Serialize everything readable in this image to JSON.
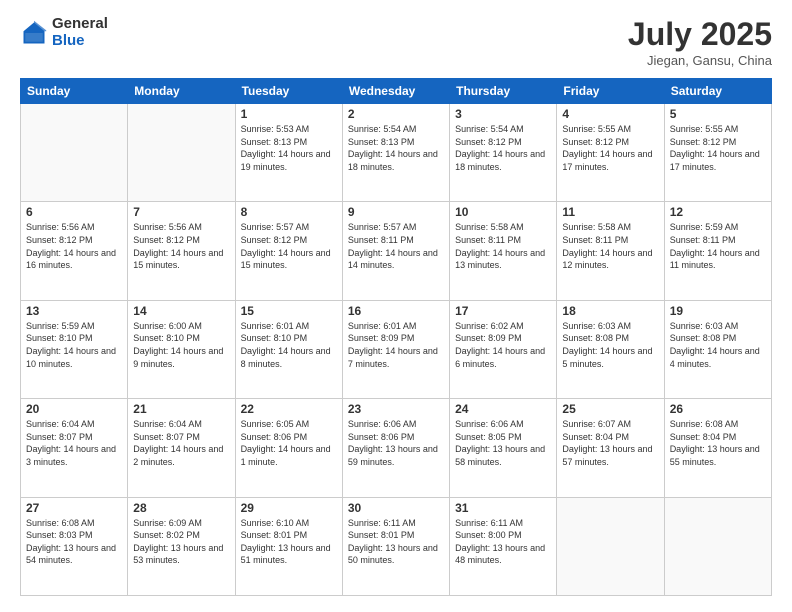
{
  "header": {
    "logo_general": "General",
    "logo_blue": "Blue",
    "month_title": "July 2025",
    "subtitle": "Jiegan, Gansu, China"
  },
  "weekdays": [
    "Sunday",
    "Monday",
    "Tuesday",
    "Wednesday",
    "Thursday",
    "Friday",
    "Saturday"
  ],
  "weeks": [
    [
      {
        "day": "",
        "sunrise": "",
        "sunset": "",
        "daylight": "",
        "empty": true
      },
      {
        "day": "",
        "sunrise": "",
        "sunset": "",
        "daylight": "",
        "empty": true
      },
      {
        "day": "1",
        "sunrise": "Sunrise: 5:53 AM",
        "sunset": "Sunset: 8:13 PM",
        "daylight": "Daylight: 14 hours and 19 minutes.",
        "empty": false
      },
      {
        "day": "2",
        "sunrise": "Sunrise: 5:54 AM",
        "sunset": "Sunset: 8:13 PM",
        "daylight": "Daylight: 14 hours and 18 minutes.",
        "empty": false
      },
      {
        "day": "3",
        "sunrise": "Sunrise: 5:54 AM",
        "sunset": "Sunset: 8:12 PM",
        "daylight": "Daylight: 14 hours and 18 minutes.",
        "empty": false
      },
      {
        "day": "4",
        "sunrise": "Sunrise: 5:55 AM",
        "sunset": "Sunset: 8:12 PM",
        "daylight": "Daylight: 14 hours and 17 minutes.",
        "empty": false
      },
      {
        "day": "5",
        "sunrise": "Sunrise: 5:55 AM",
        "sunset": "Sunset: 8:12 PM",
        "daylight": "Daylight: 14 hours and 17 minutes.",
        "empty": false
      }
    ],
    [
      {
        "day": "6",
        "sunrise": "Sunrise: 5:56 AM",
        "sunset": "Sunset: 8:12 PM",
        "daylight": "Daylight: 14 hours and 16 minutes.",
        "empty": false
      },
      {
        "day": "7",
        "sunrise": "Sunrise: 5:56 AM",
        "sunset": "Sunset: 8:12 PM",
        "daylight": "Daylight: 14 hours and 15 minutes.",
        "empty": false
      },
      {
        "day": "8",
        "sunrise": "Sunrise: 5:57 AM",
        "sunset": "Sunset: 8:12 PM",
        "daylight": "Daylight: 14 hours and 15 minutes.",
        "empty": false
      },
      {
        "day": "9",
        "sunrise": "Sunrise: 5:57 AM",
        "sunset": "Sunset: 8:11 PM",
        "daylight": "Daylight: 14 hours and 14 minutes.",
        "empty": false
      },
      {
        "day": "10",
        "sunrise": "Sunrise: 5:58 AM",
        "sunset": "Sunset: 8:11 PM",
        "daylight": "Daylight: 14 hours and 13 minutes.",
        "empty": false
      },
      {
        "day": "11",
        "sunrise": "Sunrise: 5:58 AM",
        "sunset": "Sunset: 8:11 PM",
        "daylight": "Daylight: 14 hours and 12 minutes.",
        "empty": false
      },
      {
        "day": "12",
        "sunrise": "Sunrise: 5:59 AM",
        "sunset": "Sunset: 8:11 PM",
        "daylight": "Daylight: 14 hours and 11 minutes.",
        "empty": false
      }
    ],
    [
      {
        "day": "13",
        "sunrise": "Sunrise: 5:59 AM",
        "sunset": "Sunset: 8:10 PM",
        "daylight": "Daylight: 14 hours and 10 minutes.",
        "empty": false
      },
      {
        "day": "14",
        "sunrise": "Sunrise: 6:00 AM",
        "sunset": "Sunset: 8:10 PM",
        "daylight": "Daylight: 14 hours and 9 minutes.",
        "empty": false
      },
      {
        "day": "15",
        "sunrise": "Sunrise: 6:01 AM",
        "sunset": "Sunset: 8:10 PM",
        "daylight": "Daylight: 14 hours and 8 minutes.",
        "empty": false
      },
      {
        "day": "16",
        "sunrise": "Sunrise: 6:01 AM",
        "sunset": "Sunset: 8:09 PM",
        "daylight": "Daylight: 14 hours and 7 minutes.",
        "empty": false
      },
      {
        "day": "17",
        "sunrise": "Sunrise: 6:02 AM",
        "sunset": "Sunset: 8:09 PM",
        "daylight": "Daylight: 14 hours and 6 minutes.",
        "empty": false
      },
      {
        "day": "18",
        "sunrise": "Sunrise: 6:03 AM",
        "sunset": "Sunset: 8:08 PM",
        "daylight": "Daylight: 14 hours and 5 minutes.",
        "empty": false
      },
      {
        "day": "19",
        "sunrise": "Sunrise: 6:03 AM",
        "sunset": "Sunset: 8:08 PM",
        "daylight": "Daylight: 14 hours and 4 minutes.",
        "empty": false
      }
    ],
    [
      {
        "day": "20",
        "sunrise": "Sunrise: 6:04 AM",
        "sunset": "Sunset: 8:07 PM",
        "daylight": "Daylight: 14 hours and 3 minutes.",
        "empty": false
      },
      {
        "day": "21",
        "sunrise": "Sunrise: 6:04 AM",
        "sunset": "Sunset: 8:07 PM",
        "daylight": "Daylight: 14 hours and 2 minutes.",
        "empty": false
      },
      {
        "day": "22",
        "sunrise": "Sunrise: 6:05 AM",
        "sunset": "Sunset: 8:06 PM",
        "daylight": "Daylight: 14 hours and 1 minute.",
        "empty": false
      },
      {
        "day": "23",
        "sunrise": "Sunrise: 6:06 AM",
        "sunset": "Sunset: 8:06 PM",
        "daylight": "Daylight: 13 hours and 59 minutes.",
        "empty": false
      },
      {
        "day": "24",
        "sunrise": "Sunrise: 6:06 AM",
        "sunset": "Sunset: 8:05 PM",
        "daylight": "Daylight: 13 hours and 58 minutes.",
        "empty": false
      },
      {
        "day": "25",
        "sunrise": "Sunrise: 6:07 AM",
        "sunset": "Sunset: 8:04 PM",
        "daylight": "Daylight: 13 hours and 57 minutes.",
        "empty": false
      },
      {
        "day": "26",
        "sunrise": "Sunrise: 6:08 AM",
        "sunset": "Sunset: 8:04 PM",
        "daylight": "Daylight: 13 hours and 55 minutes.",
        "empty": false
      }
    ],
    [
      {
        "day": "27",
        "sunrise": "Sunrise: 6:08 AM",
        "sunset": "Sunset: 8:03 PM",
        "daylight": "Daylight: 13 hours and 54 minutes.",
        "empty": false
      },
      {
        "day": "28",
        "sunrise": "Sunrise: 6:09 AM",
        "sunset": "Sunset: 8:02 PM",
        "daylight": "Daylight: 13 hours and 53 minutes.",
        "empty": false
      },
      {
        "day": "29",
        "sunrise": "Sunrise: 6:10 AM",
        "sunset": "Sunset: 8:01 PM",
        "daylight": "Daylight: 13 hours and 51 minutes.",
        "empty": false
      },
      {
        "day": "30",
        "sunrise": "Sunrise: 6:11 AM",
        "sunset": "Sunset: 8:01 PM",
        "daylight": "Daylight: 13 hours and 50 minutes.",
        "empty": false
      },
      {
        "day": "31",
        "sunrise": "Sunrise: 6:11 AM",
        "sunset": "Sunset: 8:00 PM",
        "daylight": "Daylight: 13 hours and 48 minutes.",
        "empty": false
      },
      {
        "day": "",
        "sunrise": "",
        "sunset": "",
        "daylight": "",
        "empty": true
      },
      {
        "day": "",
        "sunrise": "",
        "sunset": "",
        "daylight": "",
        "empty": true
      }
    ]
  ]
}
